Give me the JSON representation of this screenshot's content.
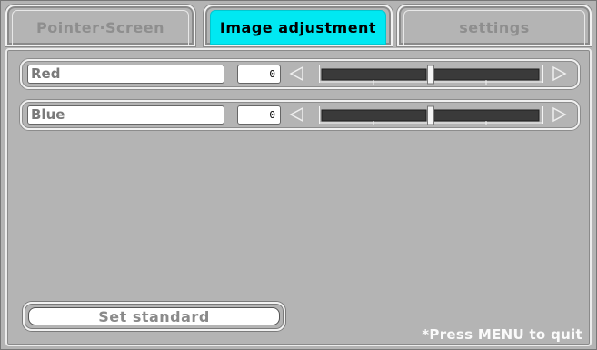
{
  "tabs": [
    {
      "label": "Pointer·Screen",
      "active": false
    },
    {
      "label": "Image adjustment",
      "active": true
    },
    {
      "label": "settings",
      "active": false
    }
  ],
  "rows": [
    {
      "label": "Red",
      "value": "0",
      "slider_fraction": 0.5
    },
    {
      "label": "Blue",
      "value": "0",
      "slider_fraction": 0.5
    }
  ],
  "buttons": {
    "set_standard": "Set standard"
  },
  "footer": {
    "hint": "*Press MENU to quit"
  },
  "colors": {
    "active_tab": "#00e8f2",
    "background": "#b4b4b4"
  },
  "icons": {
    "left": "triangle-left-icon",
    "right": "triangle-right-icon"
  }
}
